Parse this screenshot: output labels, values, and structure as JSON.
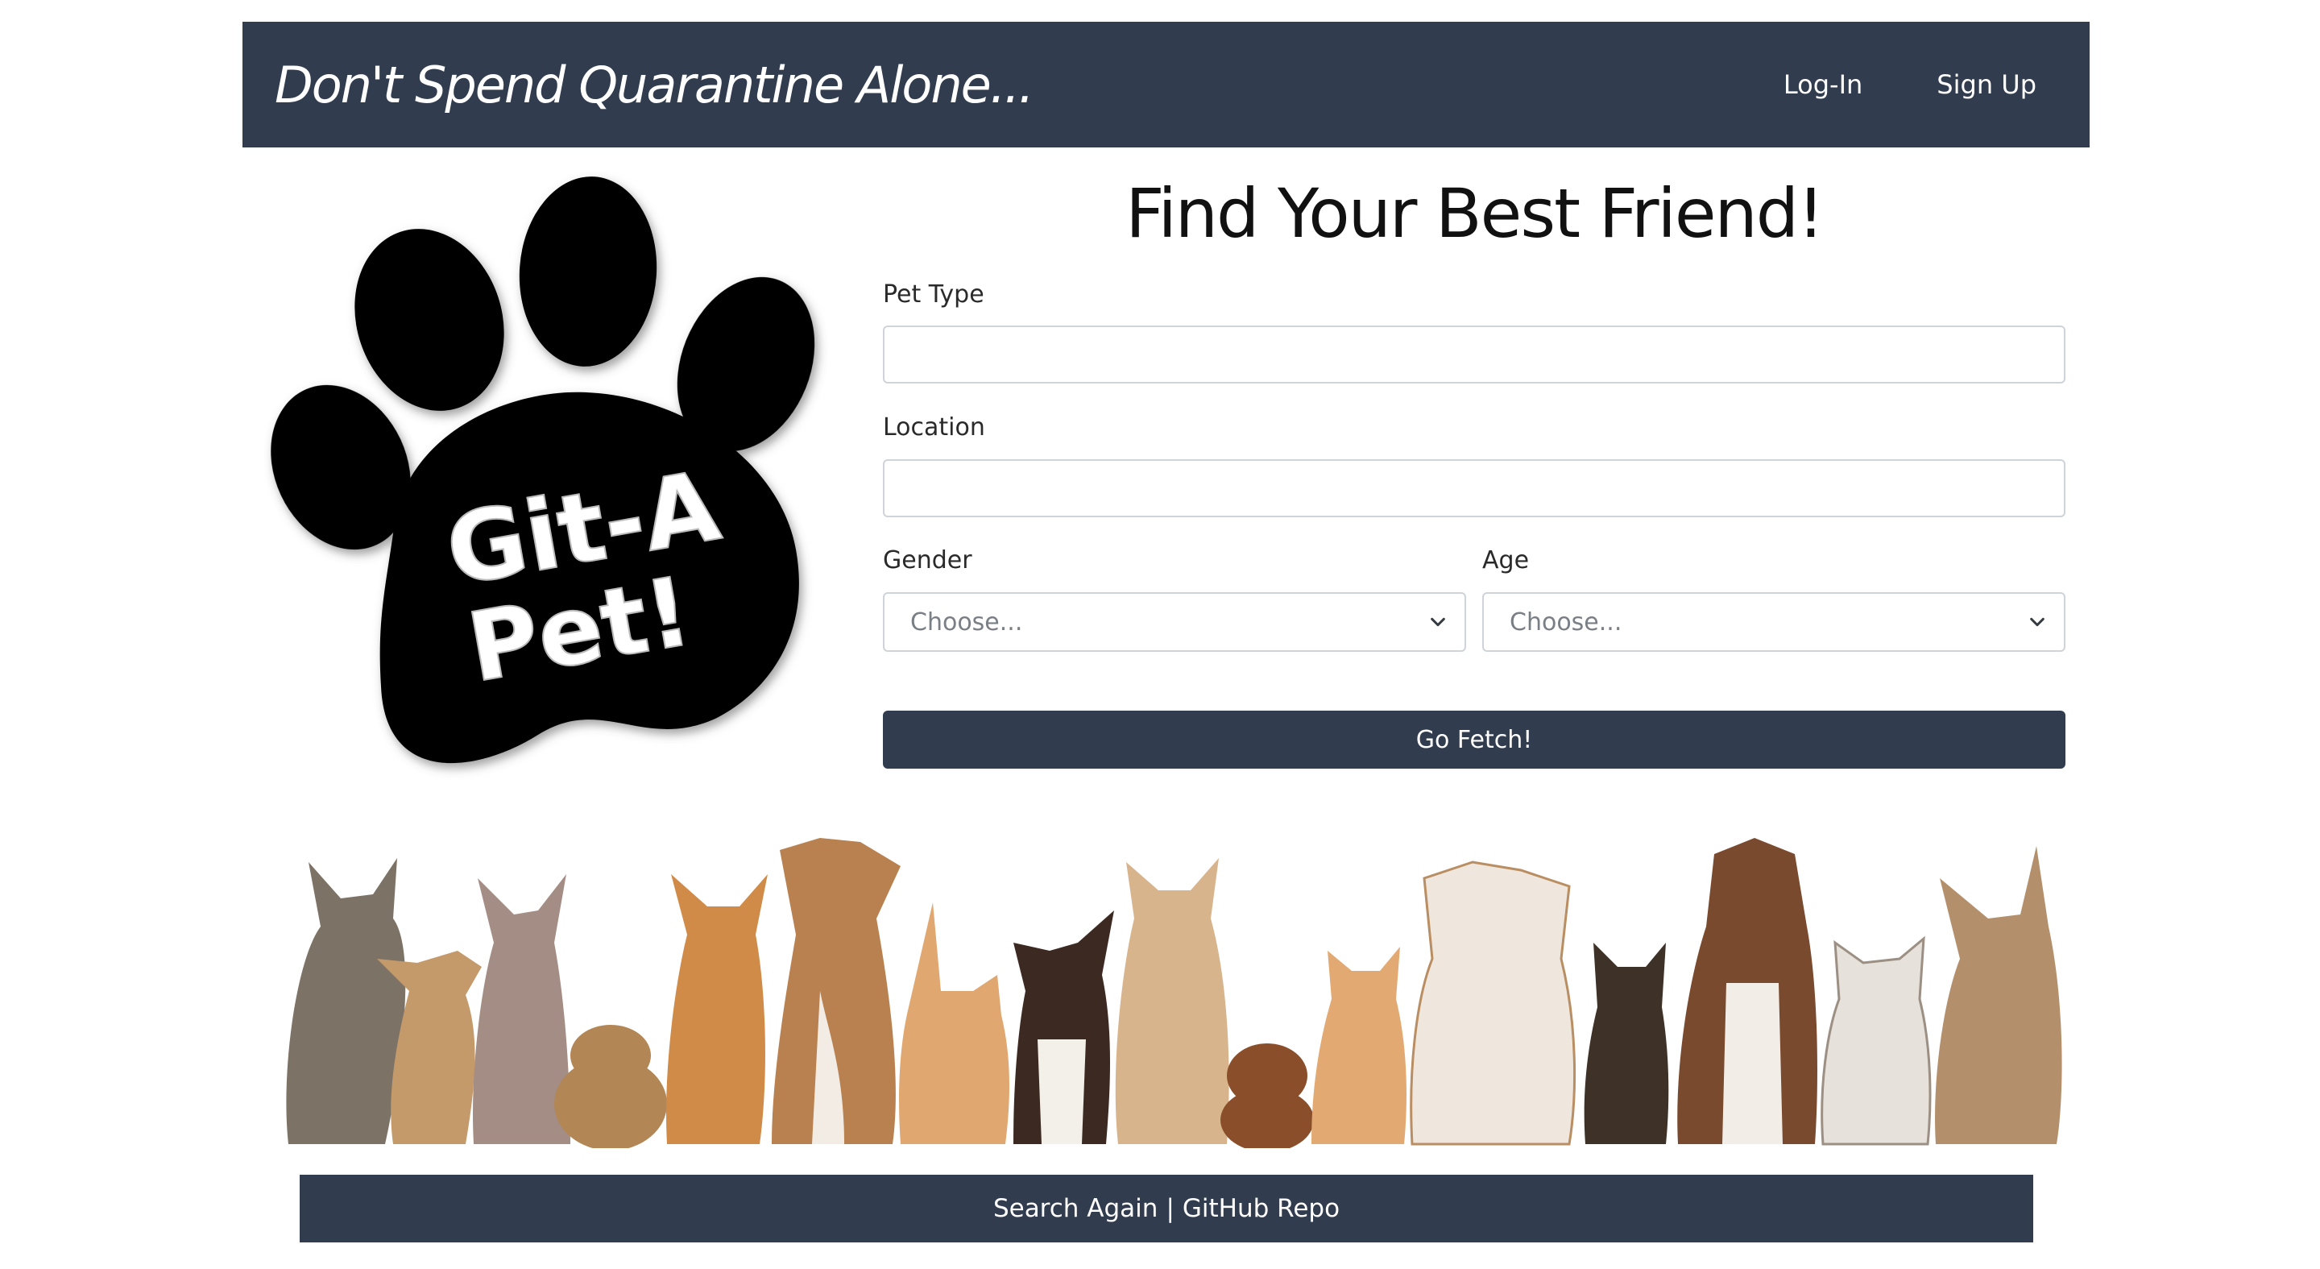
{
  "header": {
    "brand": "Don't Spend Quarantine Alone...",
    "nav": {
      "login": "Log-In",
      "signup": "Sign Up"
    }
  },
  "logo": {
    "line1": "Git-A",
    "line2": "Pet!",
    "icon": "paw-print-icon"
  },
  "form": {
    "title": "Find Your Best Friend!",
    "pet_type": {
      "label": "Pet Type",
      "value": ""
    },
    "location": {
      "label": "Location",
      "value": ""
    },
    "gender": {
      "label": "Gender",
      "selected": "Choose..."
    },
    "age": {
      "label": "Age",
      "selected": "Choose..."
    },
    "submit_label": "Go Fetch!"
  },
  "footer": {
    "search_again": "Search Again",
    "separator": "|",
    "github": "GitHub Repo"
  },
  "colors": {
    "navbar": "#313c4e",
    "button": "#313c4e",
    "footer": "#313c4e"
  }
}
